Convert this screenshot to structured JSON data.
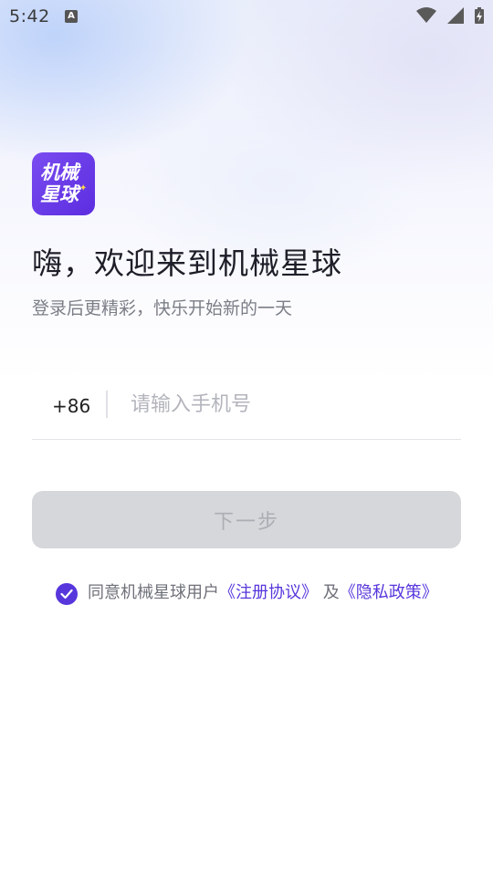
{
  "status_bar": {
    "time": "5:42",
    "notification_icon": "A"
  },
  "logo": {
    "line1": "机械",
    "line2": "星球"
  },
  "welcome": {
    "title": "嗨，欢迎来到机械星球",
    "subtitle": "登录后更精彩，快乐开始新的一天"
  },
  "phone": {
    "country_code": "+86",
    "placeholder": "请输入手机号"
  },
  "next_button": {
    "label": "下一步"
  },
  "agreement": {
    "checked": true,
    "prefix": "同意机械星球用户",
    "terms_link": "《注册协议》",
    "conjunction": " 及",
    "privacy_link": "《隐私政策》"
  },
  "colors": {
    "brand": "#5736dc",
    "button_disabled": "#d6d7db"
  }
}
